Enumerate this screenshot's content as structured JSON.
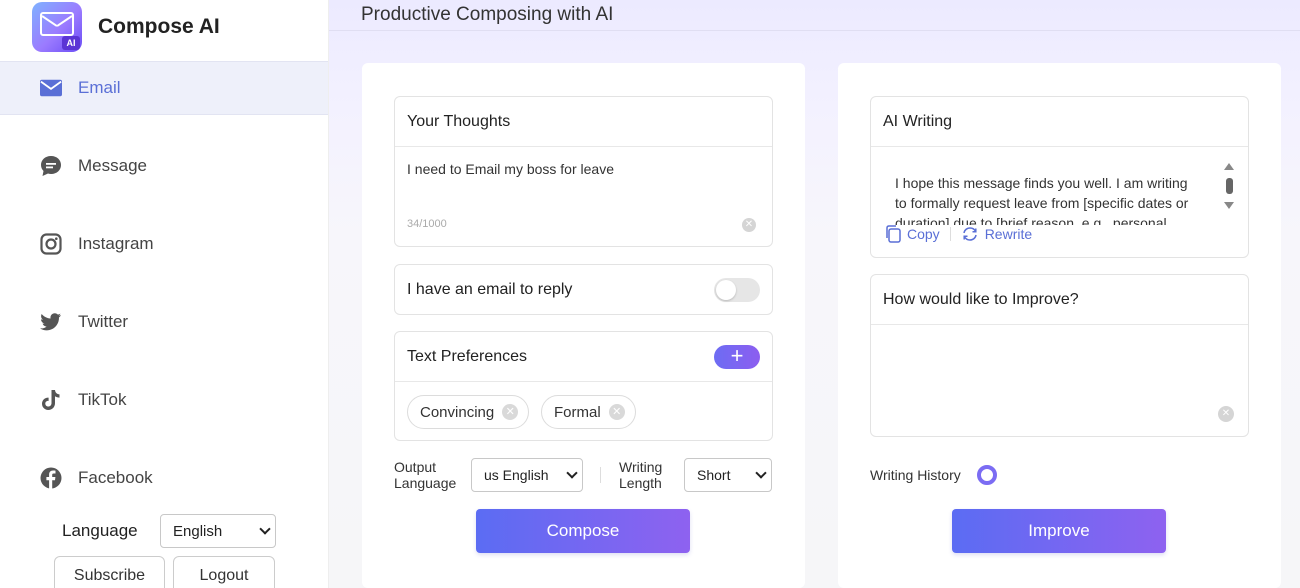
{
  "app": {
    "name": "Compose AI",
    "logo_badge": "AI"
  },
  "sidebar": {
    "items": [
      {
        "label": "Email",
        "icon": "envelope-icon"
      },
      {
        "label": "Message",
        "icon": "chat-bubble-icon"
      },
      {
        "label": "Instagram",
        "icon": "instagram-icon"
      },
      {
        "label": "Twitter",
        "icon": "twitter-icon"
      },
      {
        "label": "TikTok",
        "icon": "tiktok-icon"
      },
      {
        "label": "Facebook",
        "icon": "facebook-icon"
      }
    ],
    "language_label": "Language",
    "language_value": "English",
    "subscribe_label": "Subscribe",
    "logout_label": "Logout"
  },
  "main": {
    "title": "Productive Composing with AI",
    "thoughts": {
      "header": "Your Thoughts",
      "text": "I need to Email my boss for leave",
      "counter": "34/1000"
    },
    "reply": {
      "label": "I have an email to reply",
      "enabled": false
    },
    "preferences": {
      "header": "Text Preferences",
      "chips": [
        "Convincing",
        "Formal"
      ]
    },
    "output_language": {
      "label_line1": "Output",
      "label_line2": "Language",
      "value": "us English"
    },
    "writing_length": {
      "label_line1": "Writing",
      "label_line2": "Length",
      "value": "Short"
    },
    "compose_label": "Compose",
    "ai_writing": {
      "header": "AI Writing",
      "text_line1": "I hope this message finds you well. I am writing",
      "text_line2": "to formally request leave from [specific dates or",
      "text_line3": "duration] due to [brief reason, e.g., personal",
      "copy_label": "Copy",
      "rewrite_label": "Rewrite"
    },
    "improve": {
      "header": "How would like to Improve?",
      "text": ""
    },
    "history_label": "Writing History",
    "improve_label": "Improve"
  },
  "colors": {
    "accent": "#5a6fd6",
    "button_start": "#5b6cf3",
    "button_end": "#8e62f0"
  }
}
